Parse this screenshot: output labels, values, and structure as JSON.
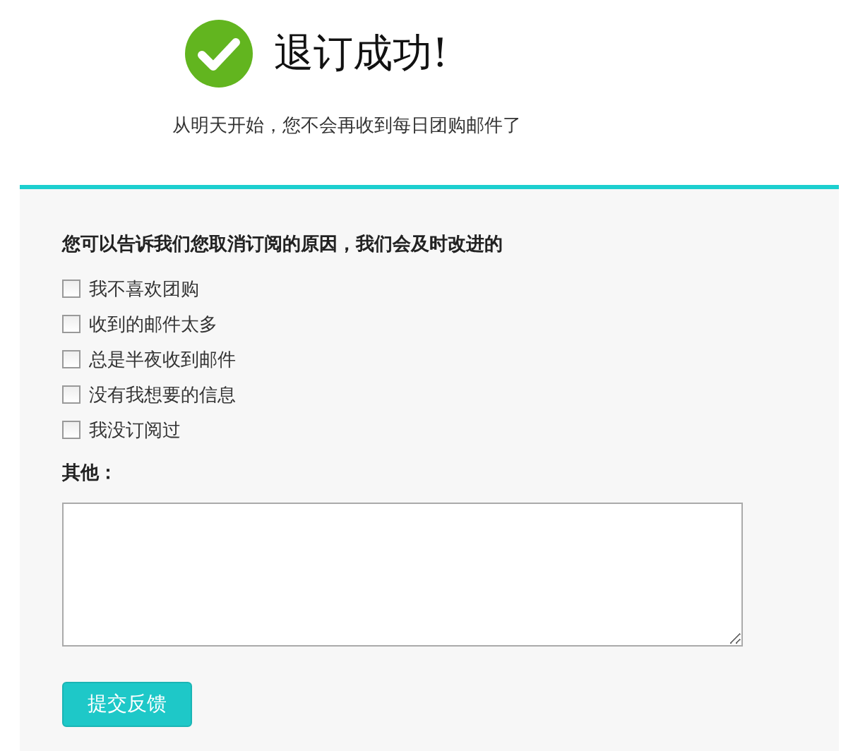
{
  "header": {
    "title": "退订成功!",
    "subtitle": "从明天开始，您不会再收到每日团购邮件了"
  },
  "feedback": {
    "question": "您可以告诉我们您取消订阅的原因，我们会及时改进的",
    "reasons": [
      {
        "label": "我不喜欢团购",
        "checked": false
      },
      {
        "label": "收到的邮件太多",
        "checked": false
      },
      {
        "label": "总是半夜收到邮件",
        "checked": false
      },
      {
        "label": "没有我想要的信息",
        "checked": false
      },
      {
        "label": "我没订阅过",
        "checked": false
      }
    ],
    "other_label": "其他：",
    "submit": "提交反馈"
  }
}
